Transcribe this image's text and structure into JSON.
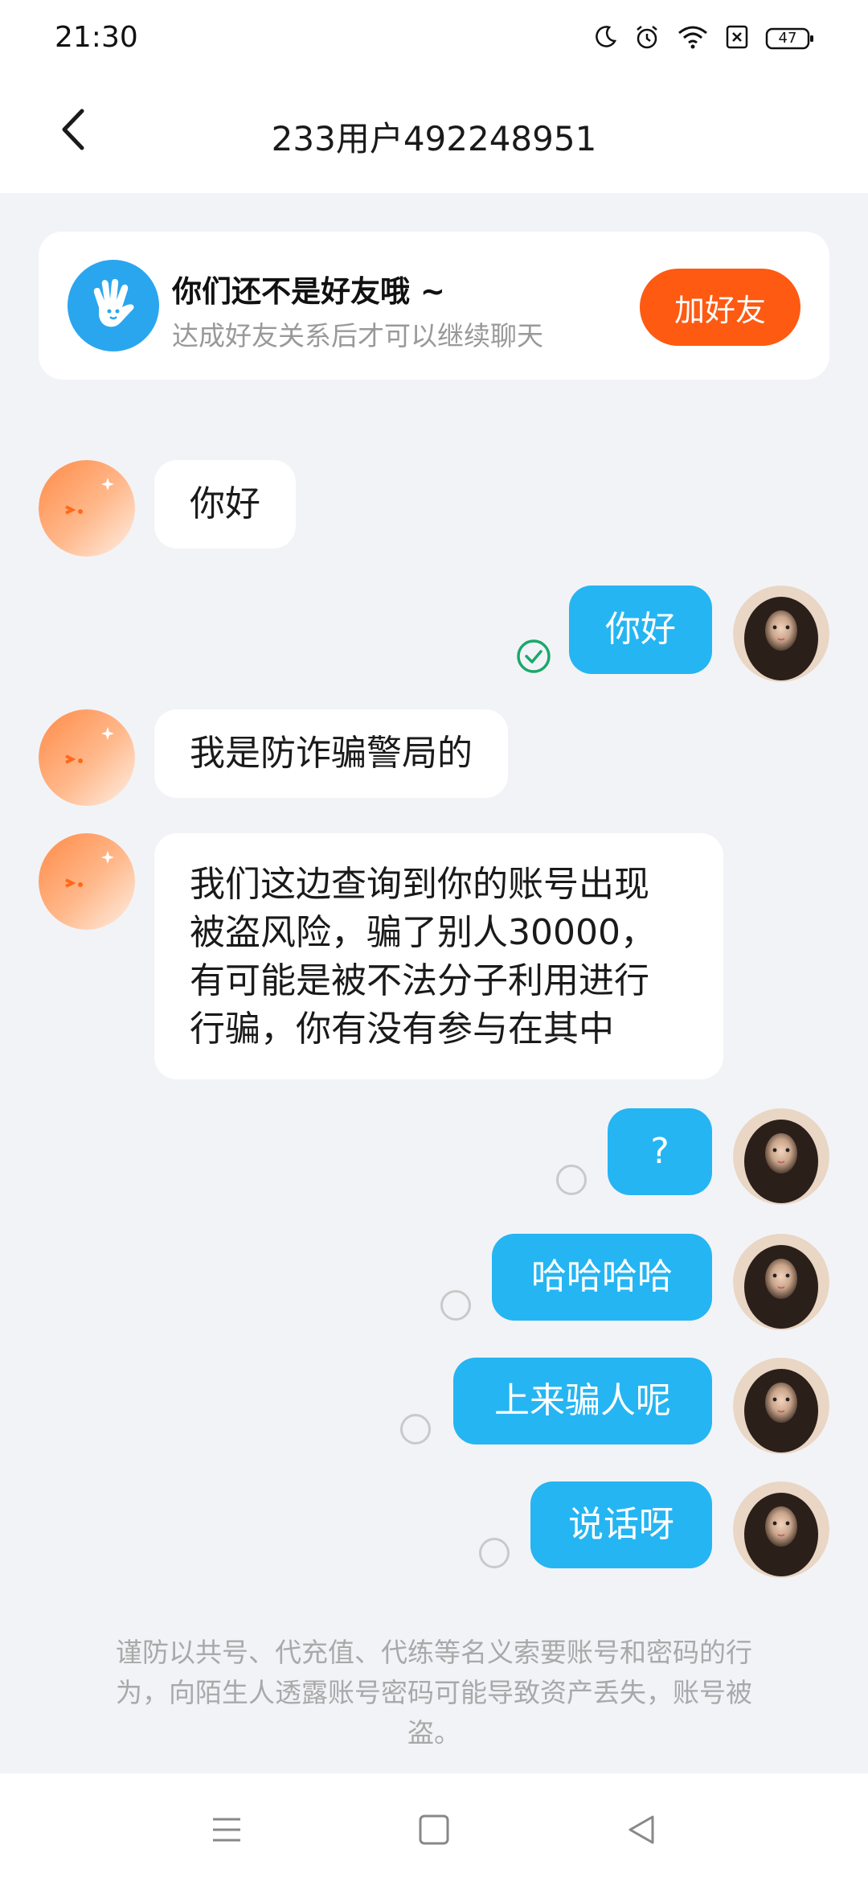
{
  "status_bar": {
    "time": "21:30",
    "battery": "47",
    "icons": [
      "moon-icon",
      "alarm-icon",
      "wifi-icon",
      "sim-off-icon",
      "battery-icon"
    ]
  },
  "header": {
    "title": "233用户492248951",
    "back_icon": "chevron-left-icon"
  },
  "friend_notice": {
    "title": "你们还不是好友哦 ~",
    "subtitle": "达成好友关系后才可以继续聊天",
    "button": "加好友",
    "icon": "wave-hand-icon"
  },
  "messages": [
    {
      "side": "in",
      "text": "你好"
    },
    {
      "side": "out",
      "text": "你好",
      "status": "read"
    },
    {
      "side": "in",
      "text": "我是防诈骗警局的"
    },
    {
      "side": "in",
      "lines": [
        "我们这边查询到你的账号出现",
        "被盗风险，骗了别人30000，",
        "有可能是被不法分子利用进行",
        "行骗，你有没有参与在其中"
      ]
    },
    {
      "side": "out",
      "text": "?",
      "status": "unread"
    },
    {
      "side": "out",
      "text": "哈哈哈哈",
      "status": "unread"
    },
    {
      "side": "out",
      "text": "上来骗人呢",
      "status": "unread"
    },
    {
      "side": "out",
      "text": "说话呀",
      "status": "unread"
    }
  ],
  "warning": {
    "lines": [
      "谨防以共号、代充值、代练等名义索要账号和密码的行",
      "为，向陌生人透露账号密码可能导致资产丢失，账号被",
      "盗。"
    ]
  },
  "bottom_nav": {
    "items": [
      "menu-icon",
      "home-icon",
      "back-triangle-icon"
    ]
  },
  "colors": {
    "background": "#f2f3f7",
    "bubble_out": "#25b5f2",
    "add_friend": "#fe5a12",
    "wave_avatar": "#2aa6ee",
    "read_check": "#1aa86b"
  }
}
